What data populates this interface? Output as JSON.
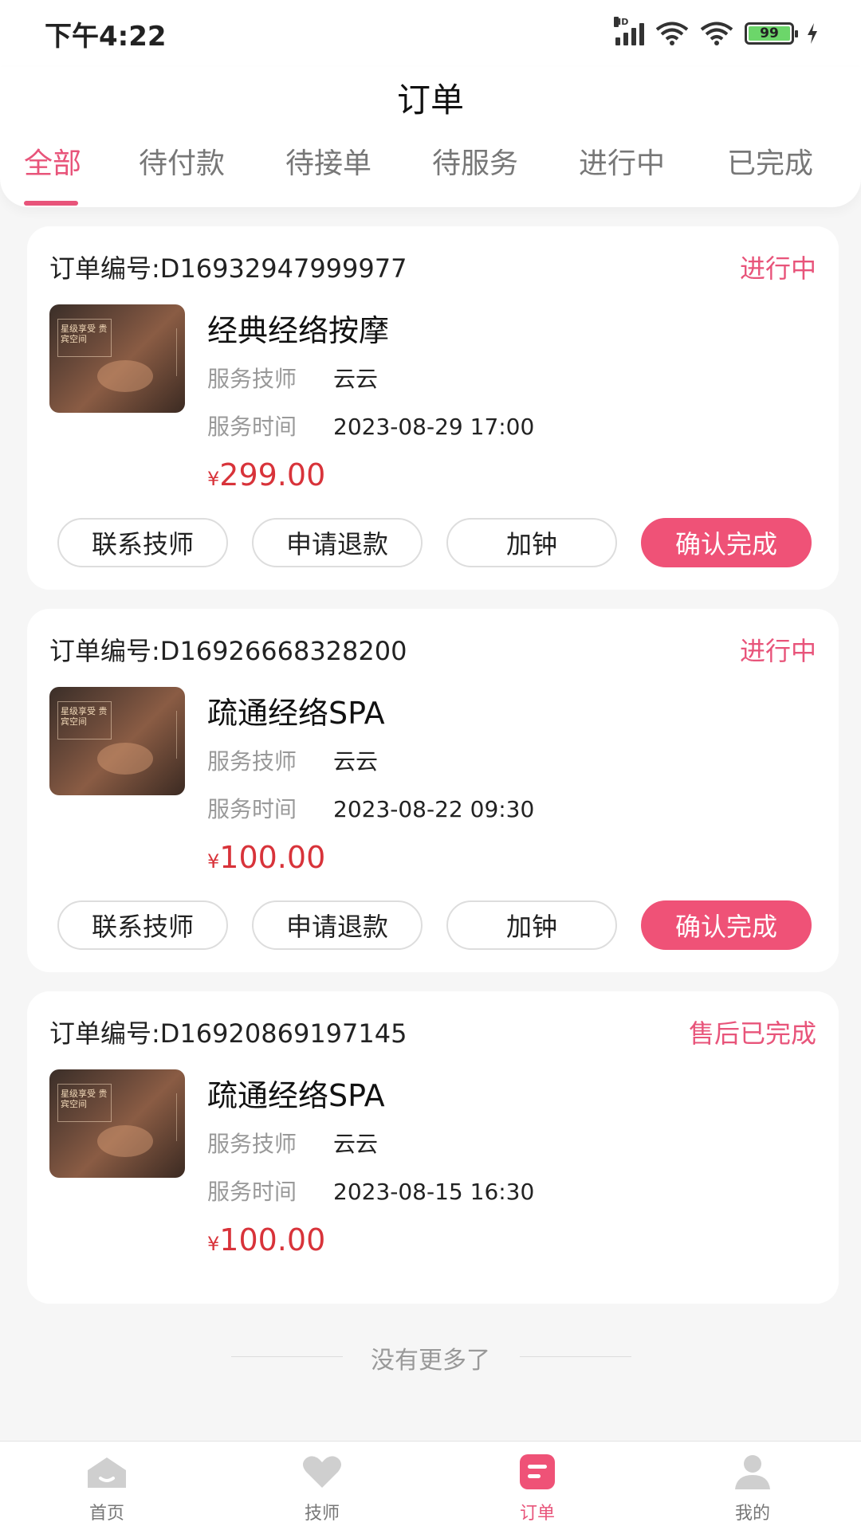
{
  "status_bar": {
    "time": "下午4:22",
    "network": "HD",
    "battery": "99"
  },
  "header": {
    "title": "订单"
  },
  "tabs": [
    {
      "label": "全部",
      "active": true
    },
    {
      "label": "待付款",
      "active": false
    },
    {
      "label": "待接单",
      "active": false
    },
    {
      "label": "待服务",
      "active": false
    },
    {
      "label": "进行中",
      "active": false
    },
    {
      "label": "已完成",
      "active": false
    }
  ],
  "orders": [
    {
      "order_no_label": "订单编号:",
      "order_no": "D16932947999977",
      "status": "进行中",
      "service_name": "经典经络按摩",
      "tech_label": "服务技师",
      "tech": "云云",
      "time_label": "服务时间",
      "time": "2023-08-29 17:00",
      "currency": "¥",
      "price": "299.00",
      "thumb_text": "星级享受 贵宾空间",
      "buttons": [
        "联系技师",
        "申请退款",
        "加钟",
        "确认完成"
      ]
    },
    {
      "order_no_label": "订单编号:",
      "order_no": "D16926668328200",
      "status": "进行中",
      "service_name": "疏通经络SPA",
      "tech_label": "服务技师",
      "tech": "云云",
      "time_label": "服务时间",
      "time": "2023-08-22 09:30",
      "currency": "¥",
      "price": "100.00",
      "thumb_text": "星级享受 贵宾空间",
      "buttons": [
        "联系技师",
        "申请退款",
        "加钟",
        "确认完成"
      ]
    },
    {
      "order_no_label": "订单编号:",
      "order_no": "D16920869197145",
      "status": "售后已完成",
      "service_name": "疏通经络SPA",
      "tech_label": "服务技师",
      "tech": "云云",
      "time_label": "服务时间",
      "time": "2023-08-15 16:30",
      "currency": "¥",
      "price": "100.00",
      "thumb_text": "星级享受 贵宾空间",
      "buttons": []
    }
  ],
  "list_end": "没有更多了",
  "tabbar": [
    {
      "label": "首页",
      "icon": "home-icon",
      "active": false
    },
    {
      "label": "技师",
      "icon": "heart-icon",
      "active": false
    },
    {
      "label": "订单",
      "icon": "order-icon",
      "active": true
    },
    {
      "label": "我的",
      "icon": "profile-icon",
      "active": false
    }
  ],
  "colors": {
    "accent": "#e8547a",
    "price": "#d8333a",
    "primary_button": "#ef5277"
  }
}
